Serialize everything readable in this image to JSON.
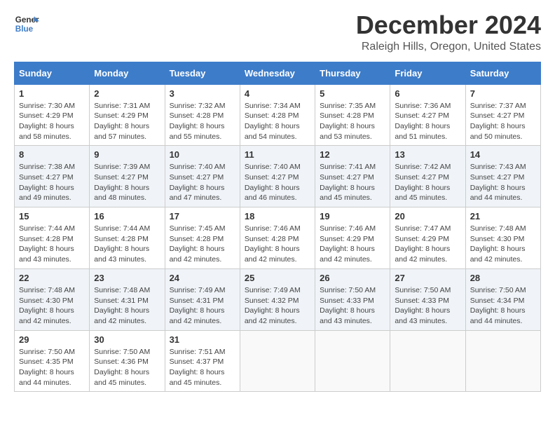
{
  "header": {
    "logo_line1": "General",
    "logo_line2": "Blue",
    "title": "December 2024",
    "subtitle": "Raleigh Hills, Oregon, United States"
  },
  "days_of_week": [
    "Sunday",
    "Monday",
    "Tuesday",
    "Wednesday",
    "Thursday",
    "Friday",
    "Saturday"
  ],
  "weeks": [
    [
      {
        "day": "1",
        "sunrise": "Sunrise: 7:30 AM",
        "sunset": "Sunset: 4:29 PM",
        "daylight": "Daylight: 8 hours and 58 minutes."
      },
      {
        "day": "2",
        "sunrise": "Sunrise: 7:31 AM",
        "sunset": "Sunset: 4:29 PM",
        "daylight": "Daylight: 8 hours and 57 minutes."
      },
      {
        "day": "3",
        "sunrise": "Sunrise: 7:32 AM",
        "sunset": "Sunset: 4:28 PM",
        "daylight": "Daylight: 8 hours and 55 minutes."
      },
      {
        "day": "4",
        "sunrise": "Sunrise: 7:34 AM",
        "sunset": "Sunset: 4:28 PM",
        "daylight": "Daylight: 8 hours and 54 minutes."
      },
      {
        "day": "5",
        "sunrise": "Sunrise: 7:35 AM",
        "sunset": "Sunset: 4:28 PM",
        "daylight": "Daylight: 8 hours and 53 minutes."
      },
      {
        "day": "6",
        "sunrise": "Sunrise: 7:36 AM",
        "sunset": "Sunset: 4:27 PM",
        "daylight": "Daylight: 8 hours and 51 minutes."
      },
      {
        "day": "7",
        "sunrise": "Sunrise: 7:37 AM",
        "sunset": "Sunset: 4:27 PM",
        "daylight": "Daylight: 8 hours and 50 minutes."
      }
    ],
    [
      {
        "day": "8",
        "sunrise": "Sunrise: 7:38 AM",
        "sunset": "Sunset: 4:27 PM",
        "daylight": "Daylight: 8 hours and 49 minutes."
      },
      {
        "day": "9",
        "sunrise": "Sunrise: 7:39 AM",
        "sunset": "Sunset: 4:27 PM",
        "daylight": "Daylight: 8 hours and 48 minutes."
      },
      {
        "day": "10",
        "sunrise": "Sunrise: 7:40 AM",
        "sunset": "Sunset: 4:27 PM",
        "daylight": "Daylight: 8 hours and 47 minutes."
      },
      {
        "day": "11",
        "sunrise": "Sunrise: 7:40 AM",
        "sunset": "Sunset: 4:27 PM",
        "daylight": "Daylight: 8 hours and 46 minutes."
      },
      {
        "day": "12",
        "sunrise": "Sunrise: 7:41 AM",
        "sunset": "Sunset: 4:27 PM",
        "daylight": "Daylight: 8 hours and 45 minutes."
      },
      {
        "day": "13",
        "sunrise": "Sunrise: 7:42 AM",
        "sunset": "Sunset: 4:27 PM",
        "daylight": "Daylight: 8 hours and 45 minutes."
      },
      {
        "day": "14",
        "sunrise": "Sunrise: 7:43 AM",
        "sunset": "Sunset: 4:27 PM",
        "daylight": "Daylight: 8 hours and 44 minutes."
      }
    ],
    [
      {
        "day": "15",
        "sunrise": "Sunrise: 7:44 AM",
        "sunset": "Sunset: 4:28 PM",
        "daylight": "Daylight: 8 hours and 43 minutes."
      },
      {
        "day": "16",
        "sunrise": "Sunrise: 7:44 AM",
        "sunset": "Sunset: 4:28 PM",
        "daylight": "Daylight: 8 hours and 43 minutes."
      },
      {
        "day": "17",
        "sunrise": "Sunrise: 7:45 AM",
        "sunset": "Sunset: 4:28 PM",
        "daylight": "Daylight: 8 hours and 42 minutes."
      },
      {
        "day": "18",
        "sunrise": "Sunrise: 7:46 AM",
        "sunset": "Sunset: 4:28 PM",
        "daylight": "Daylight: 8 hours and 42 minutes."
      },
      {
        "day": "19",
        "sunrise": "Sunrise: 7:46 AM",
        "sunset": "Sunset: 4:29 PM",
        "daylight": "Daylight: 8 hours and 42 minutes."
      },
      {
        "day": "20",
        "sunrise": "Sunrise: 7:47 AM",
        "sunset": "Sunset: 4:29 PM",
        "daylight": "Daylight: 8 hours and 42 minutes."
      },
      {
        "day": "21",
        "sunrise": "Sunrise: 7:48 AM",
        "sunset": "Sunset: 4:30 PM",
        "daylight": "Daylight: 8 hours and 42 minutes."
      }
    ],
    [
      {
        "day": "22",
        "sunrise": "Sunrise: 7:48 AM",
        "sunset": "Sunset: 4:30 PM",
        "daylight": "Daylight: 8 hours and 42 minutes."
      },
      {
        "day": "23",
        "sunrise": "Sunrise: 7:48 AM",
        "sunset": "Sunset: 4:31 PM",
        "daylight": "Daylight: 8 hours and 42 minutes."
      },
      {
        "day": "24",
        "sunrise": "Sunrise: 7:49 AM",
        "sunset": "Sunset: 4:31 PM",
        "daylight": "Daylight: 8 hours and 42 minutes."
      },
      {
        "day": "25",
        "sunrise": "Sunrise: 7:49 AM",
        "sunset": "Sunset: 4:32 PM",
        "daylight": "Daylight: 8 hours and 42 minutes."
      },
      {
        "day": "26",
        "sunrise": "Sunrise: 7:50 AM",
        "sunset": "Sunset: 4:33 PM",
        "daylight": "Daylight: 8 hours and 43 minutes."
      },
      {
        "day": "27",
        "sunrise": "Sunrise: 7:50 AM",
        "sunset": "Sunset: 4:33 PM",
        "daylight": "Daylight: 8 hours and 43 minutes."
      },
      {
        "day": "28",
        "sunrise": "Sunrise: 7:50 AM",
        "sunset": "Sunset: 4:34 PM",
        "daylight": "Daylight: 8 hours and 44 minutes."
      }
    ],
    [
      {
        "day": "29",
        "sunrise": "Sunrise: 7:50 AM",
        "sunset": "Sunset: 4:35 PM",
        "daylight": "Daylight: 8 hours and 44 minutes."
      },
      {
        "day": "30",
        "sunrise": "Sunrise: 7:50 AM",
        "sunset": "Sunset: 4:36 PM",
        "daylight": "Daylight: 8 hours and 45 minutes."
      },
      {
        "day": "31",
        "sunrise": "Sunrise: 7:51 AM",
        "sunset": "Sunset: 4:37 PM",
        "daylight": "Daylight: 8 hours and 45 minutes."
      },
      null,
      null,
      null,
      null
    ]
  ]
}
